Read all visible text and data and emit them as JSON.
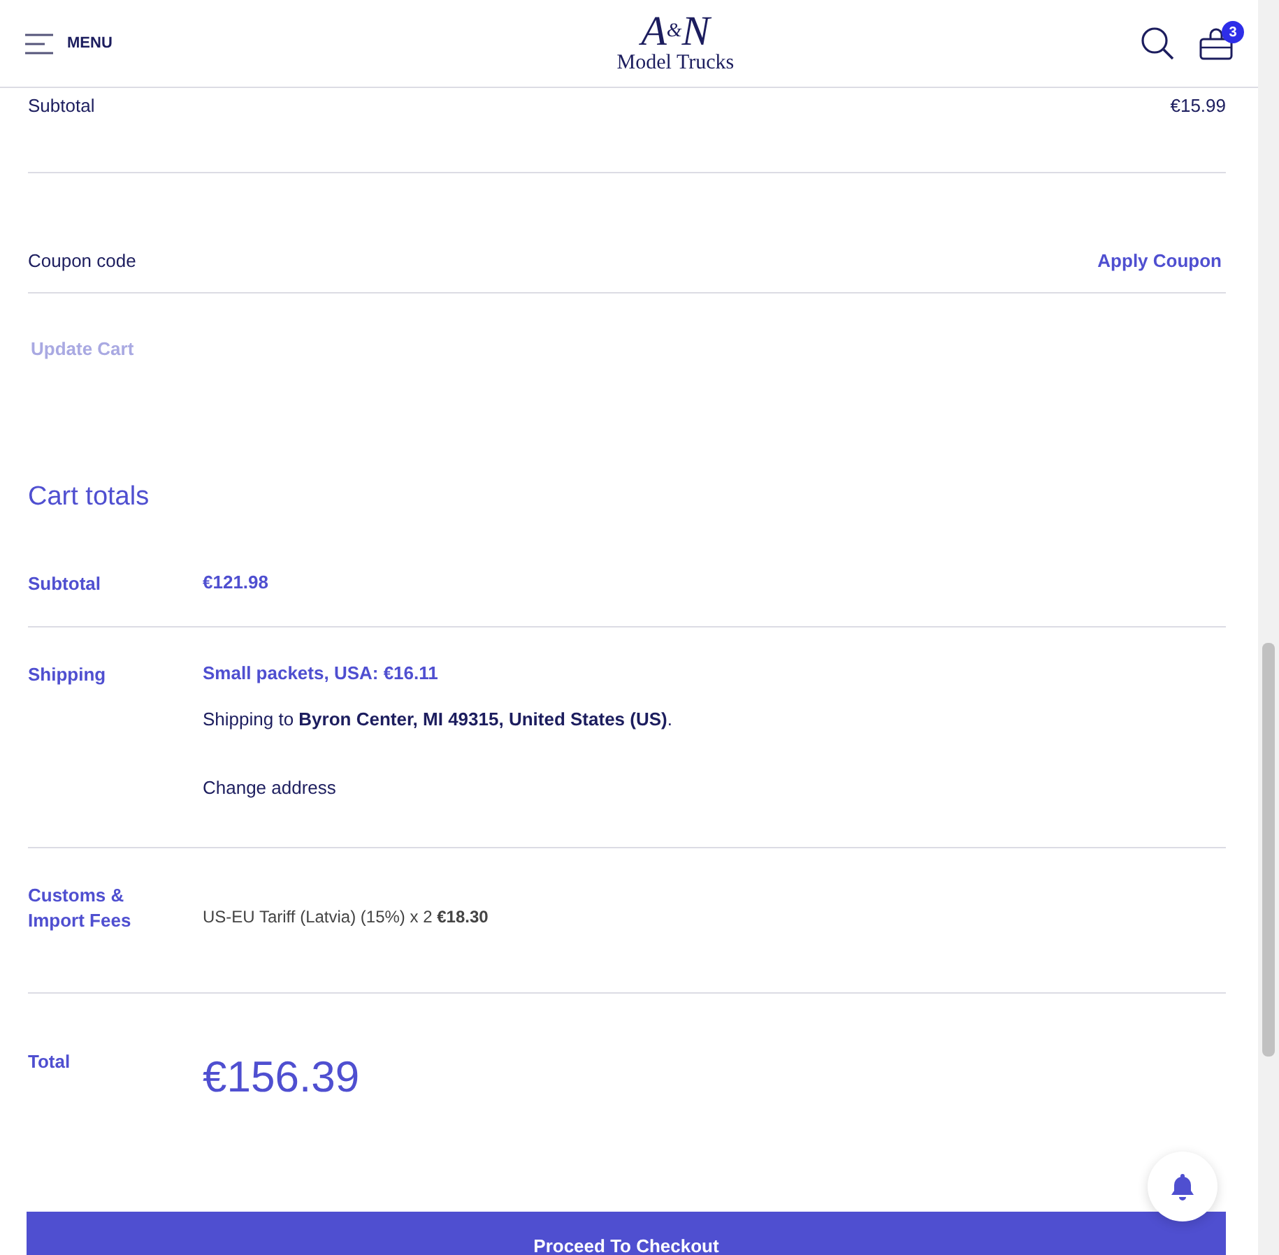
{
  "header": {
    "menu_label": "MENU",
    "logo": {
      "mark": "A$^{&}$N",
      "name": "Model Trucks"
    },
    "cart_count": "3"
  },
  "item_subtotal": {
    "label": "Subtotal",
    "value": "€15.99"
  },
  "coupon": {
    "placeholder": "Coupon code",
    "button": "Apply Coupon"
  },
  "update_cart": {
    "label": "Update Cart",
    "disabled": true
  },
  "cart_totals": {
    "title": "Cart totals",
    "rows": [
      {
        "kind": "plain",
        "label": "Subtotal",
        "value": "€121.98"
      },
      {
        "kind": "shipping",
        "label": "Shipping",
        "method": "Small packets, USA: €16.11",
        "destination": "Shipping to **Byron Center, MI 49315, United States (US)**.",
        "link": "Change address"
      },
      {
        "kind": "fee",
        "label": "Customs & Import Fees",
        "value": "US-EU Tariff (Latvia) (15%) x 2 **€18.30**"
      },
      {
        "kind": "total",
        "label": "Total",
        "value": "€156.39"
      }
    ]
  },
  "checkout_button": "Proceed To Checkout"
}
